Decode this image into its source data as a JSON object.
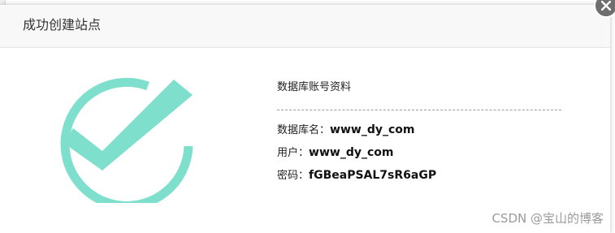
{
  "dialog": {
    "title": "成功创建站点",
    "close_icon": "close-icon"
  },
  "status_icon": {
    "name": "check-circle-icon",
    "color": "#7ddfcc"
  },
  "database_info": {
    "heading": "数据库账号资料",
    "rows": [
      {
        "label": "数据库名：",
        "value": "www_dy_com"
      },
      {
        "label": "用户：",
        "value": "www_dy_com"
      },
      {
        "label": "密码：",
        "value": "fGBeaPSAL7sR6aGP"
      }
    ]
  },
  "watermark": "CSDN @宝山的博客"
}
